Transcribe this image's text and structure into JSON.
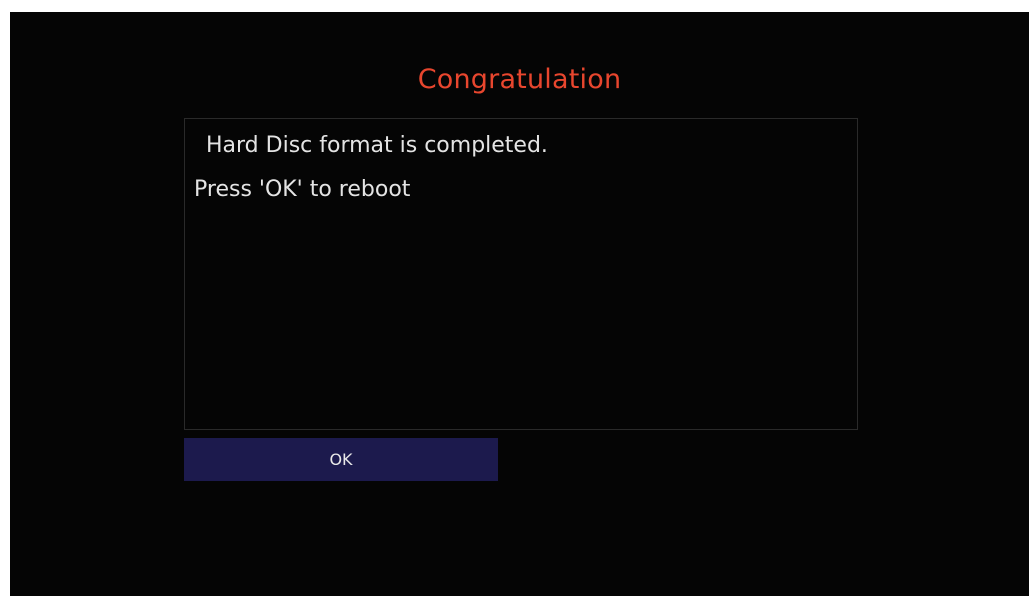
{
  "dialog": {
    "title": "Congratulation",
    "message_lines": [
      "Hard Disc format is completed.",
      "Press 'OK' to reboot"
    ],
    "ok_label": "OK"
  },
  "colors": {
    "background": "#050505",
    "title": "#e8462e",
    "text": "#e4e4e4",
    "button": "#1c1a4d"
  }
}
